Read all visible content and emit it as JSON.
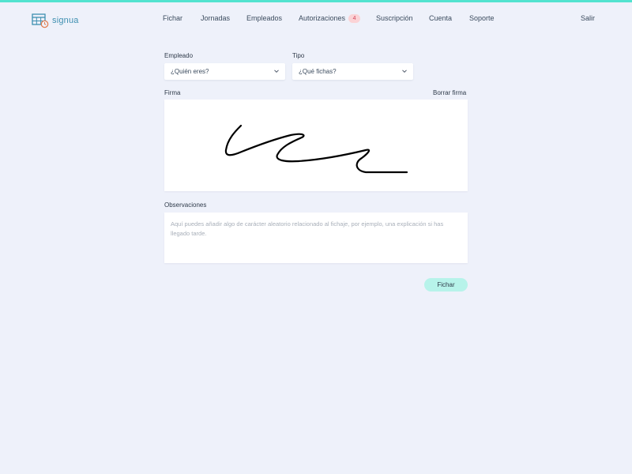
{
  "app": {
    "name": "signua"
  },
  "colors": {
    "accent": "#52e3cf",
    "button": "#b7f3ea",
    "badge_bg": "#fbd3d6",
    "badge_fg": "#d2435a"
  },
  "nav": {
    "items": [
      {
        "label": "Fichar"
      },
      {
        "label": "Jornadas"
      },
      {
        "label": "Empleados"
      },
      {
        "label": "Autorizaciones",
        "badge": "4"
      },
      {
        "label": "Suscripción"
      },
      {
        "label": "Cuenta"
      },
      {
        "label": "Soporte"
      }
    ],
    "logout": "Salir"
  },
  "form": {
    "employee": {
      "label": "Empleado",
      "value": "¿Quién eres?"
    },
    "type": {
      "label": "Tipo",
      "value": "¿Qué fichas?"
    },
    "signature": {
      "label": "Firma",
      "clear": "Borrar firma"
    },
    "notes": {
      "label": "Observaciones",
      "placeholder": "Aquí puedes añadir algo de carácter aleatorio relacionado al fichaje, por ejemplo, una explicación si has llegado tarde."
    },
    "submit": "Fichar"
  },
  "icons": {
    "logo": "calendar-clock-icon",
    "dropdown": "chevron-down-icon"
  }
}
